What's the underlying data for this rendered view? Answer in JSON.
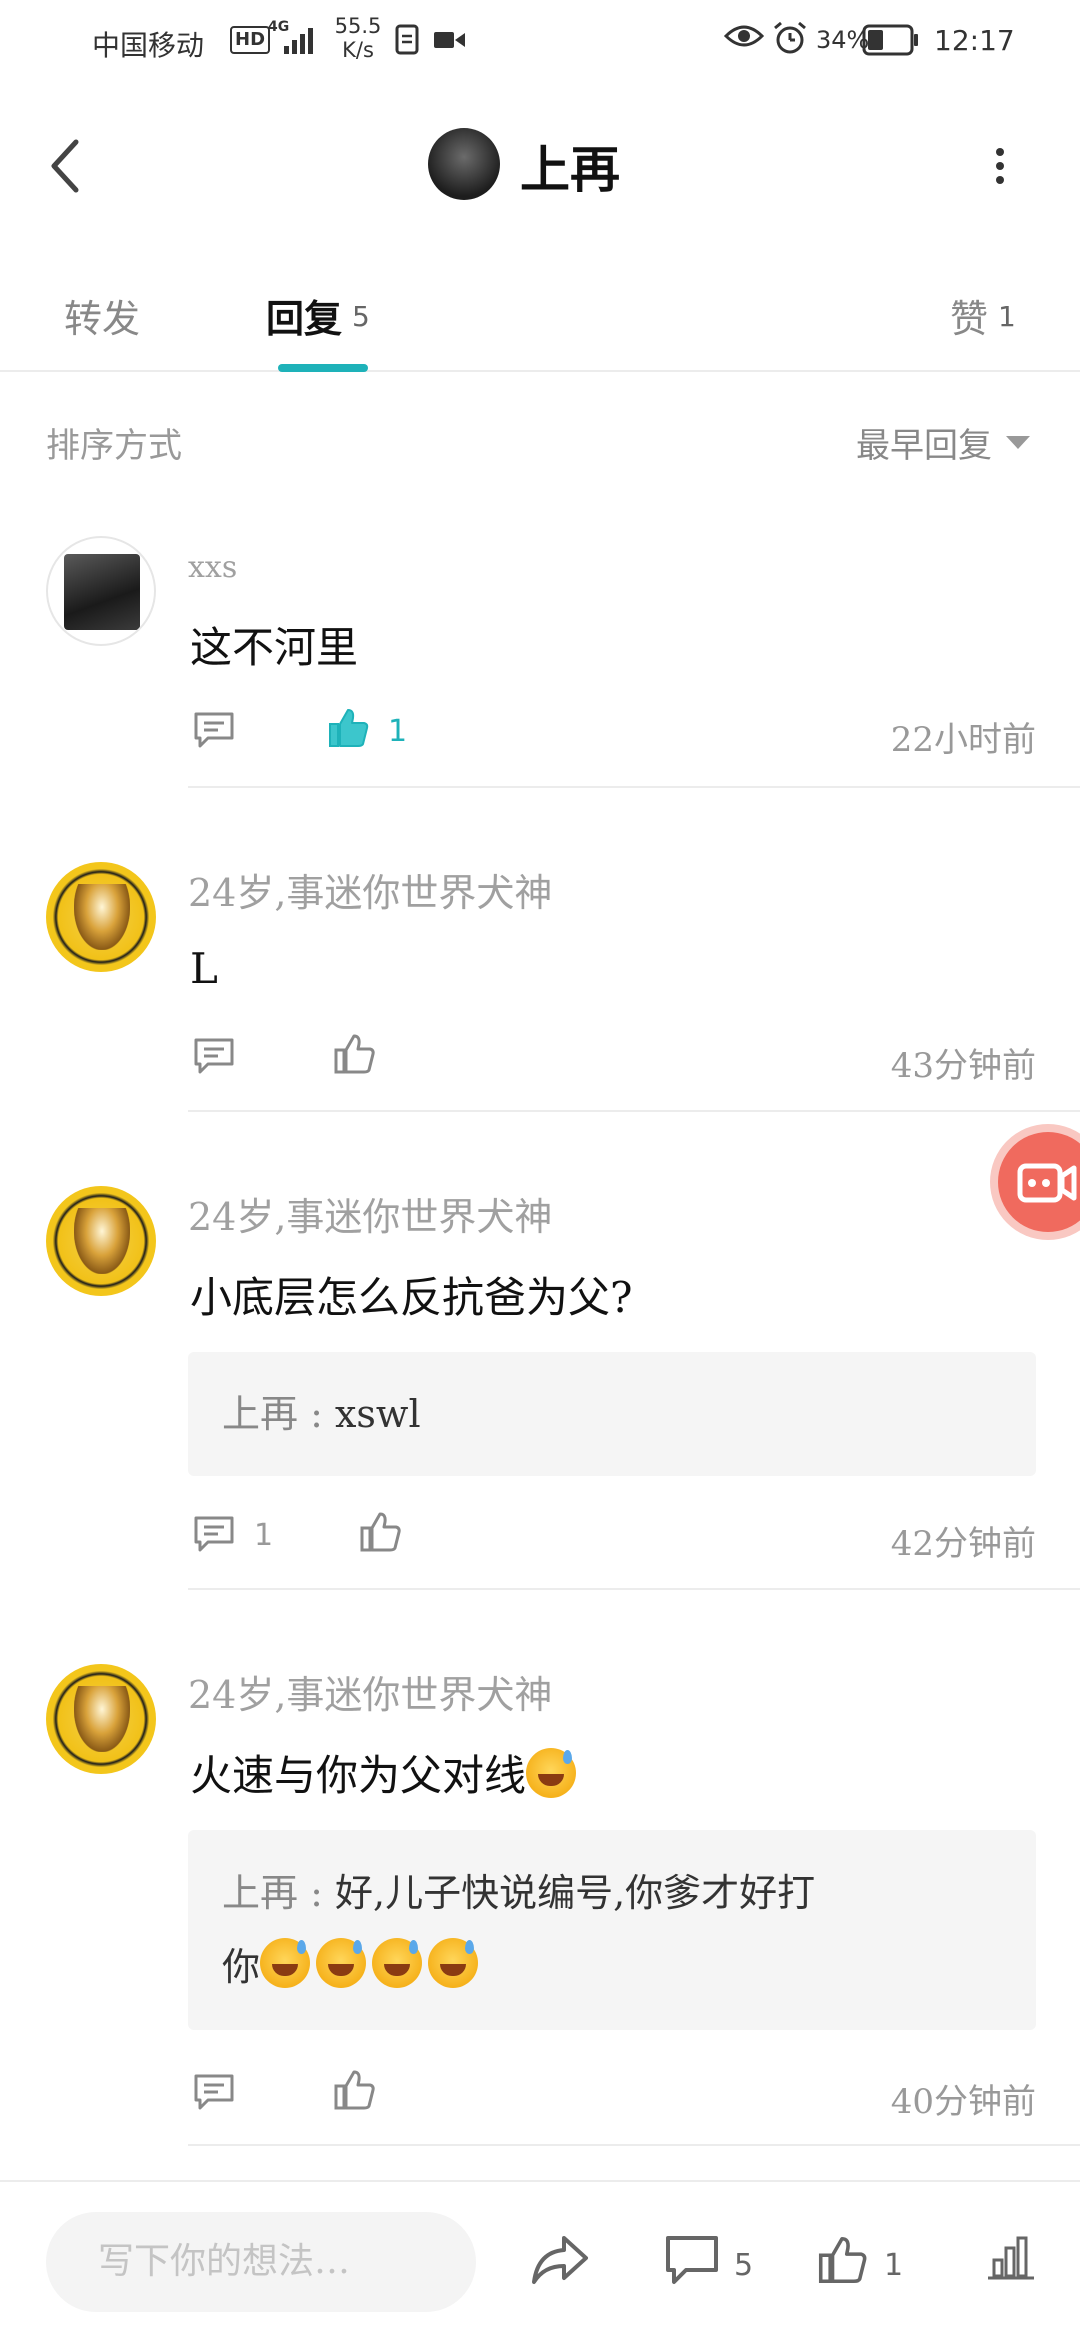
{
  "status_bar": {
    "carrier": "中国移动",
    "hd": "HD",
    "network": "4G",
    "speed_value": "55.5",
    "speed_unit": "K/s",
    "battery": "34%",
    "time": "12:17"
  },
  "header": {
    "title": "上再"
  },
  "tabs": [
    {
      "label": "转发"
    },
    {
      "label": "回复",
      "count": "5"
    },
    {
      "label": "赞",
      "count": "1"
    }
  ],
  "sort": {
    "label": "排序方式",
    "selected": "最早回复"
  },
  "comments": [
    {
      "author": "xxs",
      "text": "这不河里",
      "reply_count": "",
      "like_count": "1",
      "liked": true,
      "time": "22小时前"
    },
    {
      "author": "24岁,事迷你世界犬神",
      "text": "L",
      "reply_count": "",
      "like_count": "",
      "time": "43分钟前"
    },
    {
      "author": "24岁,事迷你世界犬神",
      "text": "小底层怎么反抗爸为父?",
      "quote_author": "上再",
      "quote_text": "xswl",
      "reply_count": "1",
      "like_count": "",
      "time": "42分钟前"
    },
    {
      "author": "24岁,事迷你世界犬神",
      "text": "火速与你为父对线",
      "quote_author": "上再",
      "quote_text_line1": "好,儿子快说编号,你爹才好打",
      "quote_text_line2": "你",
      "reply_count": "",
      "like_count": "",
      "time": "40分钟前"
    }
  ],
  "bottom_bar": {
    "input_placeholder": "写下你的想法…",
    "comment_count": "5",
    "like_count": "1"
  },
  "colors": {
    "accent": "#1eb2b9",
    "record_button": "#f06a5e"
  }
}
